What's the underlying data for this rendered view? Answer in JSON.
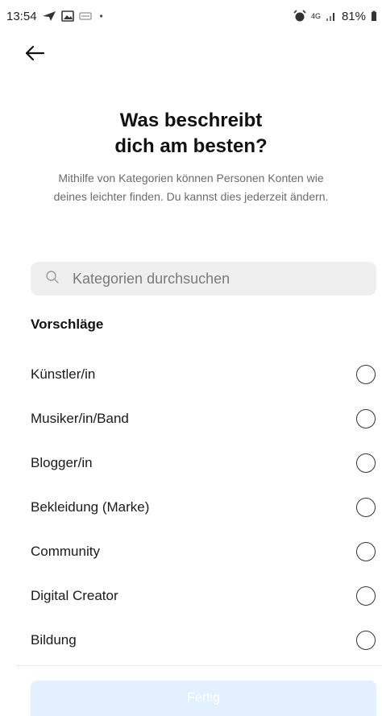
{
  "status_bar": {
    "time": "13:54",
    "network": "4G",
    "battery": "81%",
    "icons": [
      "send-icon",
      "image-icon",
      "notification-icon",
      "alarm-icon",
      "signal-icon",
      "battery-icon"
    ]
  },
  "header": {
    "back_icon": "arrow-left-icon"
  },
  "main": {
    "title_line1": "Was beschreibt",
    "title_line2": "dich am besten?",
    "subtitle": "Mithilfe von Kategorien können Personen Konten wie deines leichter finden. Du kannst dies jederzeit ändern."
  },
  "search": {
    "placeholder": "Kategorien durchsuchen",
    "value": "",
    "icon": "search-icon"
  },
  "suggestions": {
    "heading": "Vorschläge",
    "items": [
      {
        "label": "Künstler/in",
        "selected": false
      },
      {
        "label": "Musiker/in/Band",
        "selected": false
      },
      {
        "label": "Blogger/in",
        "selected": false
      },
      {
        "label": "Bekleidung (Marke)",
        "selected": false
      },
      {
        "label": "Community",
        "selected": false
      },
      {
        "label": "Digital Creator",
        "selected": false
      },
      {
        "label": "Bildung",
        "selected": false
      }
    ]
  },
  "footer": {
    "done_label": "Fertig",
    "done_enabled": false
  },
  "colors": {
    "primary_disabled": "#e3f0ff",
    "search_bg": "#efefef",
    "text_secondary": "#6b6b6b"
  }
}
